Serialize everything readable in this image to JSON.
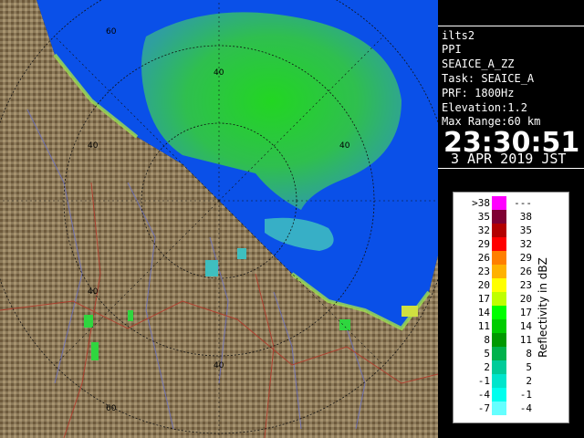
{
  "info": {
    "site": "ilts2",
    "scan": "PPI",
    "product": "SEAICE_A_ZZ",
    "task": "Task: SEAICE_A",
    "prf": "PRF: 1800Hz",
    "elevation": "Elevation:1.2",
    "max_range": "Max Range:60 km",
    "time": "23:30:51",
    "date": "3 APR 2019 JST"
  },
  "legend": {
    "axis_label": "Reflectivity in dBZ",
    "rows": [
      {
        "lo": ">38",
        "hi": "---",
        "color": "#ff00ff"
      },
      {
        "lo": "35",
        "hi": "38",
        "color": "#7f0033"
      },
      {
        "lo": "32",
        "hi": "35",
        "color": "#b30000"
      },
      {
        "lo": "29",
        "hi": "32",
        "color": "#ff0000"
      },
      {
        "lo": "26",
        "hi": "29",
        "color": "#ff7f00"
      },
      {
        "lo": "23",
        "hi": "26",
        "color": "#ffb200"
      },
      {
        "lo": "20",
        "hi": "23",
        "color": "#ffff00"
      },
      {
        "lo": "17",
        "hi": "20",
        "color": "#bfff00"
      },
      {
        "lo": "14",
        "hi": "17",
        "color": "#00ff00"
      },
      {
        "lo": "11",
        "hi": "14",
        "color": "#00cc00"
      },
      {
        "lo": "8",
        "hi": "11",
        "color": "#009900"
      },
      {
        "lo": "5",
        "hi": "8",
        "color": "#00b24c"
      },
      {
        "lo": "2",
        "hi": "5",
        "color": "#00cc99"
      },
      {
        "lo": "-1",
        "hi": "2",
        "color": "#00e5cc"
      },
      {
        "lo": "-4",
        "hi": "-1",
        "color": "#00ffee"
      },
      {
        "lo": "-7",
        "hi": "-4",
        "color": "#66ffff"
      }
    ]
  },
  "map": {
    "range_labels": [
      "60",
      "40",
      "40",
      "40",
      "40",
      "40",
      "60"
    ],
    "colors": {
      "sea": "#0a50e8",
      "land": "#8c7a5a",
      "echo": "#2fcc2f"
    }
  }
}
